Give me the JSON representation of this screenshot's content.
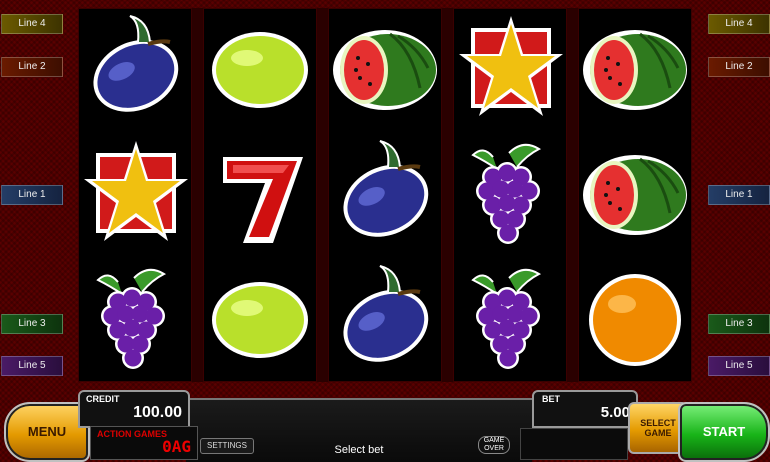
{
  "paylines": {
    "left": [
      {
        "label": "Line 4",
        "color": "#6b5a00"
      },
      {
        "label": "Line 2",
        "color": "#6a1a00"
      },
      {
        "label": "Line 1",
        "color": "#243d66"
      },
      {
        "label": "Line 3",
        "color": "#1a5a1a"
      },
      {
        "label": "Line 5",
        "color": "#4a1a66"
      }
    ],
    "right": [
      {
        "label": "Line 4",
        "color": "#6b5a00"
      },
      {
        "label": "Line 2",
        "color": "#6a1a00"
      },
      {
        "label": "Line 1",
        "color": "#243d66"
      },
      {
        "label": "Line 3",
        "color": "#1a5a1a"
      },
      {
        "label": "Line 5",
        "color": "#4a1a66"
      }
    ]
  },
  "reels": [
    [
      "plum",
      "star",
      "grapes"
    ],
    [
      "lemon",
      "seven",
      "lemon"
    ],
    [
      "watermelon",
      "plum",
      "plum"
    ],
    [
      "star",
      "grapes",
      "grapes"
    ],
    [
      "watermelon",
      "watermelon",
      "orange"
    ]
  ],
  "panel": {
    "menu_label": "MENU",
    "credit_label": "CREDIT",
    "credit_value": "100.00",
    "action_label": "ACTION GAMES",
    "action_value": "0AG",
    "settings_label": "SETTINGS",
    "message": "Select bet",
    "gameover_label": "GAME OVER",
    "bet_label": "BET",
    "bet_value": "5.00",
    "select_game_label": "SELECT GAME",
    "start_label": "START"
  }
}
